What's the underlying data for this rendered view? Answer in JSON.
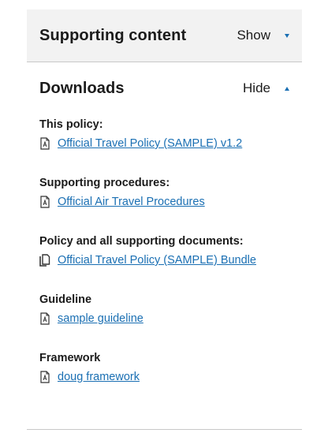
{
  "supporting": {
    "title": "Supporting content",
    "toggle_label": "Show",
    "toggle_icon": "triangle-down-icon"
  },
  "downloads": {
    "title": "Downloads",
    "toggle_label": "Hide",
    "toggle_icon": "triangle-up-icon",
    "groups": [
      {
        "label": "This policy:",
        "link": "Official Travel Policy (SAMPLE) v1.2",
        "icon": "pdf-file-icon"
      },
      {
        "label": "Supporting procedures:",
        "link": "Official Air Travel Procedures",
        "icon": "pdf-file-icon"
      },
      {
        "label": "Policy and all supporting documents:",
        "link": "Official Travel Policy (SAMPLE) Bundle",
        "icon": "document-bundle-icon"
      },
      {
        "label": "Guideline",
        "link": "sample guideline",
        "icon": "pdf-file-icon"
      },
      {
        "label": "Framework",
        "link": "doug framework",
        "icon": "pdf-file-icon"
      }
    ]
  },
  "colors": {
    "link": "#1a6fb3",
    "header_bg": "#f2f2f2",
    "divider": "#c8c8c8"
  }
}
